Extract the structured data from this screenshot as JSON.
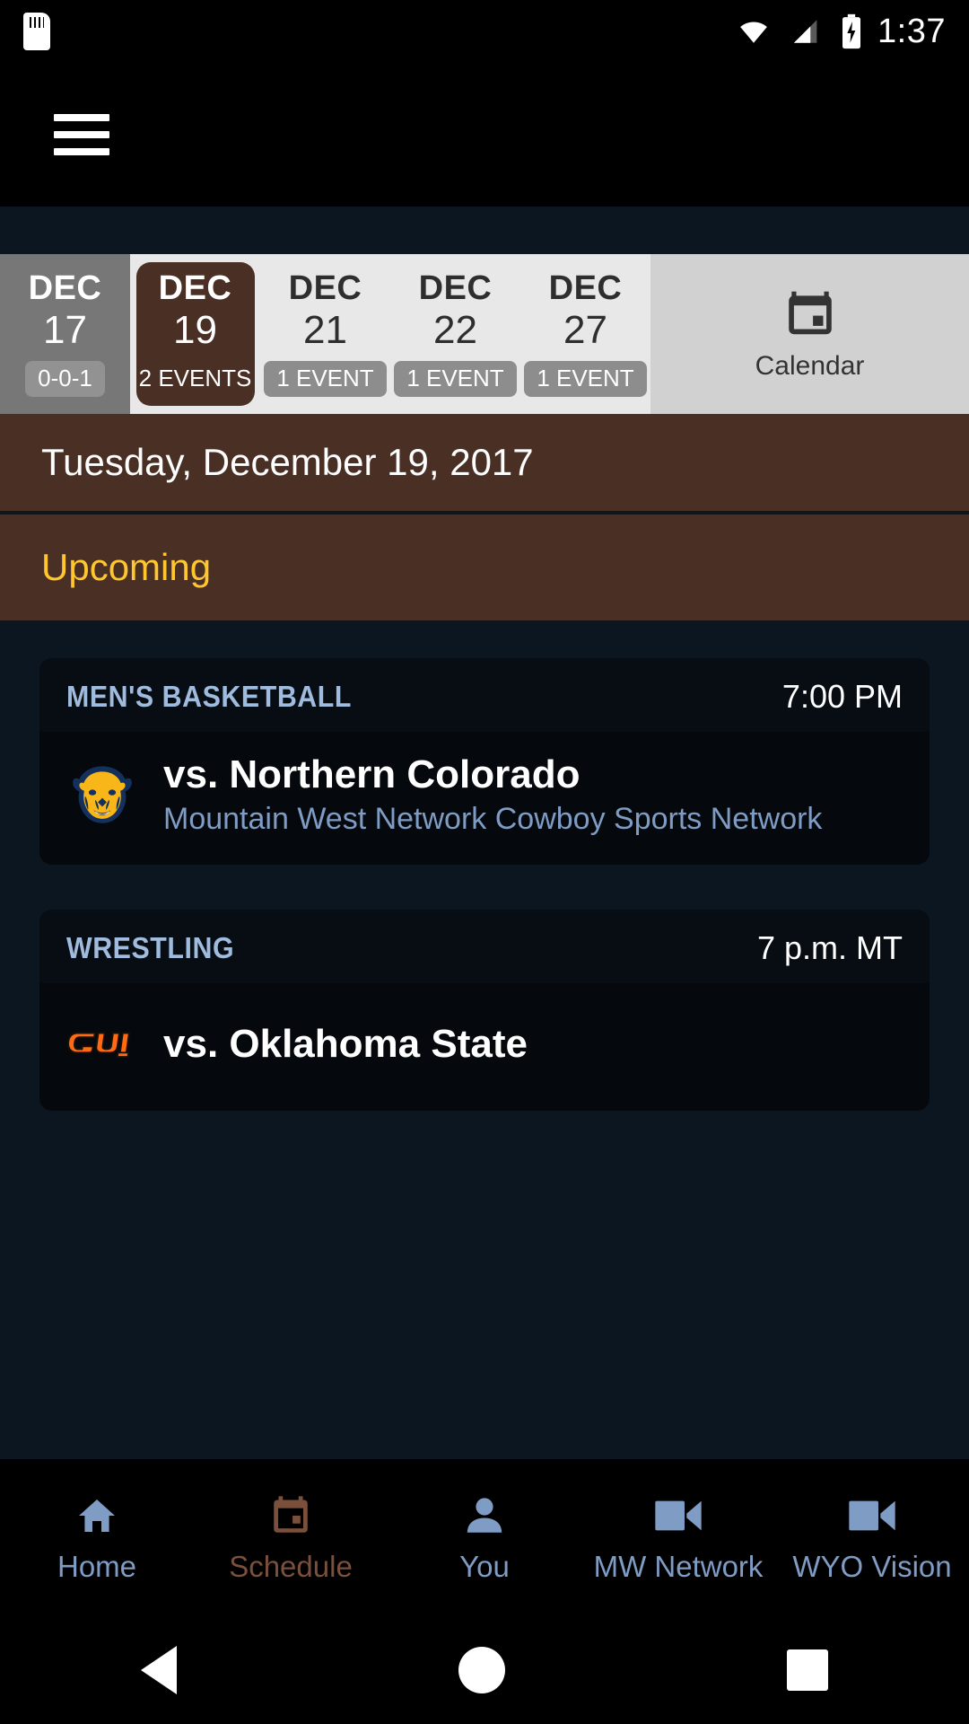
{
  "status_bar": {
    "sd_card_icon": "sd-card-icon",
    "wifi_icon": "wifi-icon",
    "signal_icon": "signal-icon",
    "battery_icon": "battery-charging-icon",
    "time": "1:37"
  },
  "app_bar": {
    "menu_icon": "hamburger-menu-icon"
  },
  "date_strip": {
    "days": [
      {
        "month": "DEC",
        "day": "17",
        "badge": "0-0-1",
        "state": "past"
      },
      {
        "month": "DEC",
        "day": "19",
        "badge": "2 EVENTS",
        "state": "selected"
      },
      {
        "month": "DEC",
        "day": "21",
        "badge": "1 EVENT",
        "state": "plain"
      },
      {
        "month": "DEC",
        "day": "22",
        "badge": "1 EVENT",
        "state": "plain"
      },
      {
        "month": "DEC",
        "day": "27",
        "badge": "1 EVENT",
        "state": "plain"
      }
    ],
    "calendar_button": {
      "label": "Calendar",
      "icon": "calendar-icon"
    }
  },
  "date_header": {
    "text": "Tuesday, December 19, 2017"
  },
  "section": {
    "title": "Upcoming"
  },
  "events": [
    {
      "sport": "MEN'S BASKETBALL",
      "time": "7:00 PM",
      "opponent": "vs. Northern Colorado",
      "networks": "Mountain West Network Cowboy Sports Network",
      "logo_icon": "northern-colorado-bear-logo"
    },
    {
      "sport": "WRESTLING",
      "time": "7 p.m. MT",
      "opponent": "vs. Oklahoma State",
      "networks": "",
      "logo_icon": "oklahoma-state-osu-logo"
    }
  ],
  "bottom_nav": [
    {
      "label": "Home",
      "icon": "home-icon",
      "active": false
    },
    {
      "label": "Schedule",
      "icon": "calendar-icon",
      "active": true
    },
    {
      "label": "You",
      "icon": "person-icon",
      "active": false
    },
    {
      "label": "MW Network",
      "icon": "video-camera-icon",
      "active": false
    },
    {
      "label": "WYO Vision",
      "icon": "video-camera-icon",
      "active": false
    }
  ],
  "android_nav": {
    "back_icon": "back-triangle-icon",
    "home_icon": "home-circle-icon",
    "recents_icon": "recents-square-icon"
  },
  "colors": {
    "brown": "#4a2f24",
    "gold": "#ffc62f",
    "accent_blue": "#7e9cc4",
    "background": "#0b1620"
  }
}
